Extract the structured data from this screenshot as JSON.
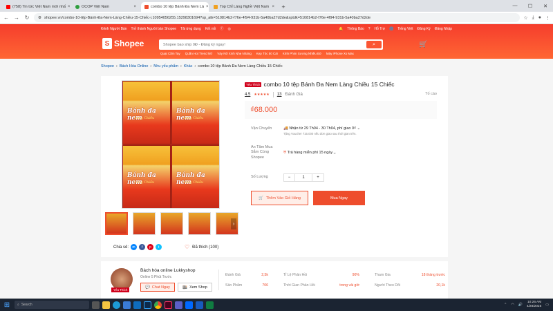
{
  "browser": {
    "tabs": [
      {
        "title": "(758) Tin tức Việt Nam mới nhấ",
        "color": "#ff0000",
        "active": false
      },
      {
        "title": "OCOP Việt Nam",
        "color": "#2e9e3e",
        "active": false
      },
      {
        "title": "combo 10 tệp Bánh Đa Nem Là",
        "color": "#ee4d2d",
        "active": true
      },
      {
        "title": "Top Chỉ Làng Nghề Việt Nam",
        "color": "#f0a020",
        "active": false
      }
    ],
    "url": "shopee.vn/combo-10-tệp-Bánh-Đa-Nem-Làng-Chiều-15-Chiếc-i.10954056255.15298301694?sp_atk=510814b2-f76e-4f94-931b-5a40ba27d2de&xptdk=510814b2-f76e-4f94-931b-5a40ba27d2de"
  },
  "header": {
    "topnav_left": [
      "Kênh Người Bán",
      "Trở thành Người bán Shopee",
      "Tải ứng dụng",
      "Kết nối"
    ],
    "topnav_right": [
      "Thông Báo",
      "Hỗ Trợ",
      "Tiếng Việt",
      "Đăng Ký",
      "Đăng Nhập"
    ],
    "logo": "Shopee",
    "search_placeholder": "Shopee bao ship 0Đ - Đăng ký ngay!",
    "hot_keywords": [
      "Quạt Cầm Tay",
      "Quần Hot Trend Nữ",
      "Váy Nữ Xinh Nhẹ Nhàng",
      "Kẹp Tóc 50 Cái",
      "Kính Phim Sương Nhiều Bờ",
      "Máy iPhone Xs Max"
    ]
  },
  "breadcrumb": [
    "Shopee",
    "Bách Hóa Online",
    "Nhu yếu phẩm",
    "Khác",
    "combo 10 tệp Bánh Đa Nem Làng Chiều 15 Chiếc"
  ],
  "product": {
    "badge": "Yêu Thích",
    "title": "combo 10 tệp Bánh Đa Nem Làng Chiều 15 Chiếc",
    "rating": "4.5",
    "stars": "★★★★★",
    "review_count": "13",
    "review_label": "Đánh Giá",
    "report": "Tố cáo",
    "price": "₫68.000",
    "image_title": "Bánh đa nem",
    "image_subtitle": "Làng Chiều",
    "shipping_label": "Vận Chuyển",
    "shipping_value": "Nhận từ 29 Th04 - 30 Th04, phí giao 0₫",
    "shipping_sub": "Tặng Voucher ₫15.000 nếu đơn giao sau thời gian trên.",
    "assure_label": "An Tâm Mua Sắm Cùng Shopee",
    "assure_value": "Trả hàng miễn phí 15 ngày",
    "qty_label": "Số Lượng",
    "qty_value": "1",
    "add_cart": "Thêm Vào Giỏ Hàng",
    "buy_now": "Mua Ngay",
    "share_label": "Chia sẻ:",
    "liked": "Đã thích (100)"
  },
  "shop": {
    "name": "Bách hóa online Lukkyshop",
    "online": "Online 5 Phút Trước",
    "badge": "Yêu Thích",
    "chat": "Chat Ngay",
    "view": "Xem Shop",
    "stats": [
      {
        "label": "Đánh Giá",
        "value": "2,5k"
      },
      {
        "label": "Tỉ Lệ Phản Hồi",
        "value": "90%"
      },
      {
        "label": "Tham Gia",
        "value": "18 tháng trước"
      },
      {
        "label": "Sản Phẩm",
        "value": "706"
      },
      {
        "label": "Thời Gian Phản Hồi",
        "value": "trong vài giờ"
      },
      {
        "label": "Người Theo Dõi",
        "value": "20,1k"
      }
    ]
  },
  "taskbar": {
    "search": "Search",
    "time": "10:26 AM",
    "date": "4/28/2025"
  }
}
